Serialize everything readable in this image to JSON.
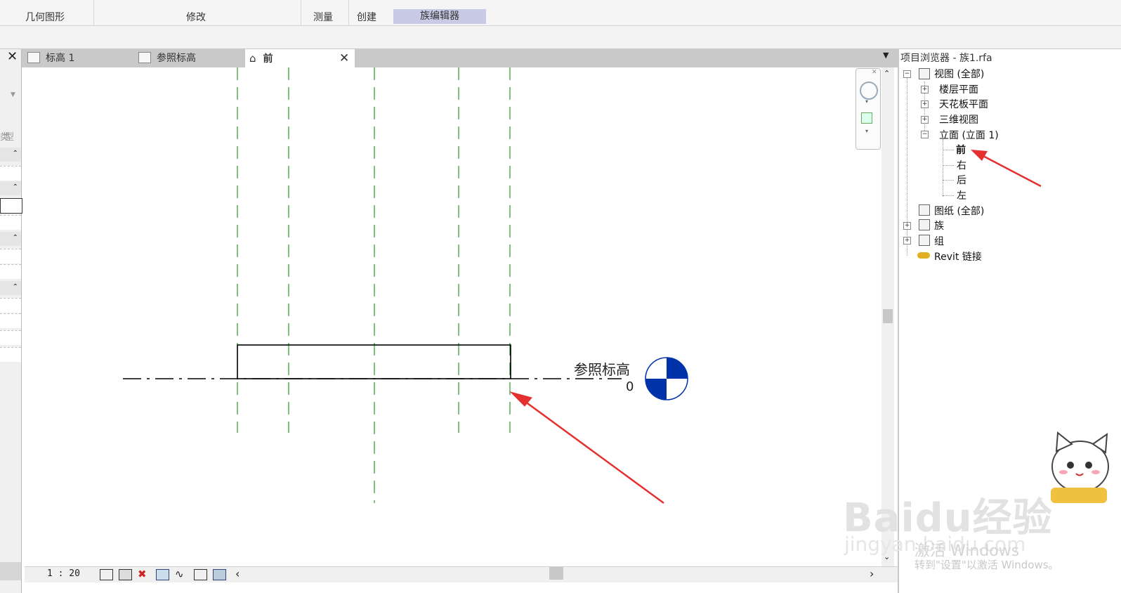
{
  "ribbon": {
    "groups": {
      "geometry": "几何图形",
      "modify": "修改",
      "measure": "测量",
      "create": "创建",
      "family_editor": "族编辑器"
    },
    "accent": "#c9cbe6"
  },
  "left_panel": {
    "type_label": "类型"
  },
  "tabs": [
    {
      "label": "标高 1"
    },
    {
      "label": "参照标高"
    },
    {
      "label": "前",
      "active": true
    }
  ],
  "canvas": {
    "level_name": "参照标高",
    "level_value": "0",
    "colors": {
      "ref_plane": "#008000",
      "level_marker": "#0033aa",
      "arrow": "#e53030"
    }
  },
  "status_bar": {
    "scale": "1 : 20"
  },
  "project_browser": {
    "title": "项目浏览器 - 族1.rfa",
    "tree": {
      "views": "视图 (全部)",
      "floor_plans": "楼层平面",
      "ceiling_plans": "天花板平面",
      "views_3d": "三维视图",
      "elevations": "立面 (立面 1)",
      "elev_front": "前",
      "elev_right": "右",
      "elev_back": "后",
      "elev_left": "左",
      "sheets": "图纸 (全部)",
      "families": "族",
      "groups": "组",
      "revit_links": "Revit 链接"
    }
  },
  "watermarks": {
    "activate": "激活 Windows",
    "activate_sub": "转到\"设置\"以激活 Windows。",
    "baidu": "Baidu经验",
    "baidu_url": "jingyan.baidu.com"
  }
}
